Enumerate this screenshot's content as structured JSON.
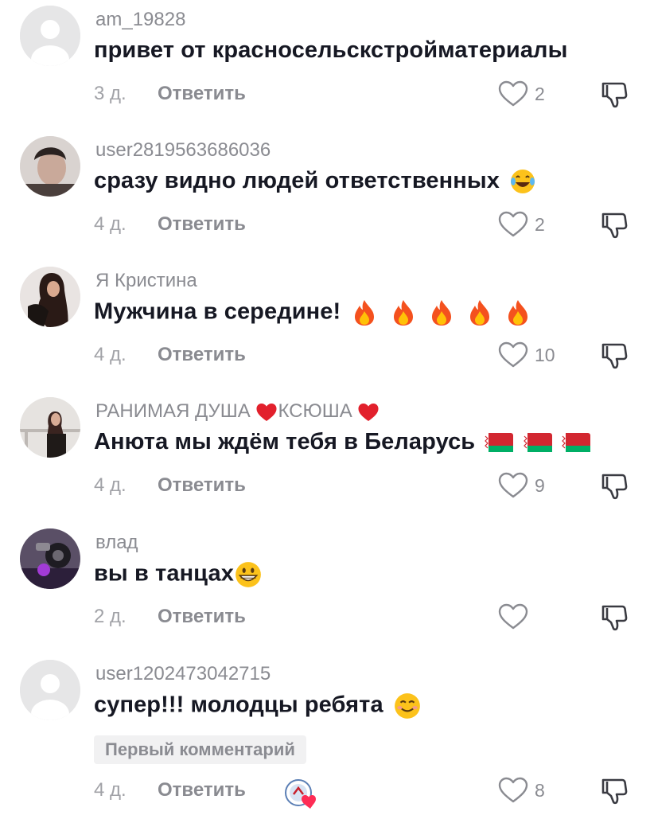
{
  "actions": {
    "reply_label": "Ответить"
  },
  "comments": [
    {
      "username": "am_19828",
      "text": "привет от красносельскстройматериалы",
      "time": "3 д.",
      "likes": "2",
      "avatar": "default-avatar",
      "emojis": []
    },
    {
      "username": "user2819563686036",
      "text": "сразу видно людей ответственных",
      "time": "4 д.",
      "likes": "2",
      "avatar": "photo-avatar",
      "emojis": [
        "tears-of-joy"
      ]
    },
    {
      "username": "Я Кристина",
      "text": "Мужчина в середине!",
      "time": "4 д.",
      "likes": "10",
      "avatar": "photo-avatar",
      "emojis": [
        "fire",
        "fire",
        "fire",
        "fire",
        "fire"
      ]
    },
    {
      "username_parts": [
        "РАНИМАЯ ДУША ",
        "КСЮША "
      ],
      "username_emojis": [
        "red-heart",
        "red-heart"
      ],
      "text": "Анюта мы ждём тебя в Беларусь",
      "time": "4 д.",
      "likes": "9",
      "avatar": "photo-avatar",
      "emojis": [
        "belarus-flag",
        "belarus-flag",
        "belarus-flag"
      ]
    },
    {
      "username": "влад",
      "text": "вы в танцах",
      "time": "2 д.",
      "likes": "",
      "avatar": "photo-avatar",
      "emojis": [
        "grinning"
      ]
    },
    {
      "username": "user1202473042715",
      "text": "супер!!! молодцы ребята",
      "time": "4 д.",
      "likes": "8",
      "avatar": "default-avatar",
      "emojis": [
        "smiling"
      ],
      "badge": "Первый комментарий",
      "creator_liked": true
    }
  ],
  "colors": {
    "primary_text": "#161823",
    "secondary_text": "#8a8b91",
    "heart": "#fe2c55"
  }
}
